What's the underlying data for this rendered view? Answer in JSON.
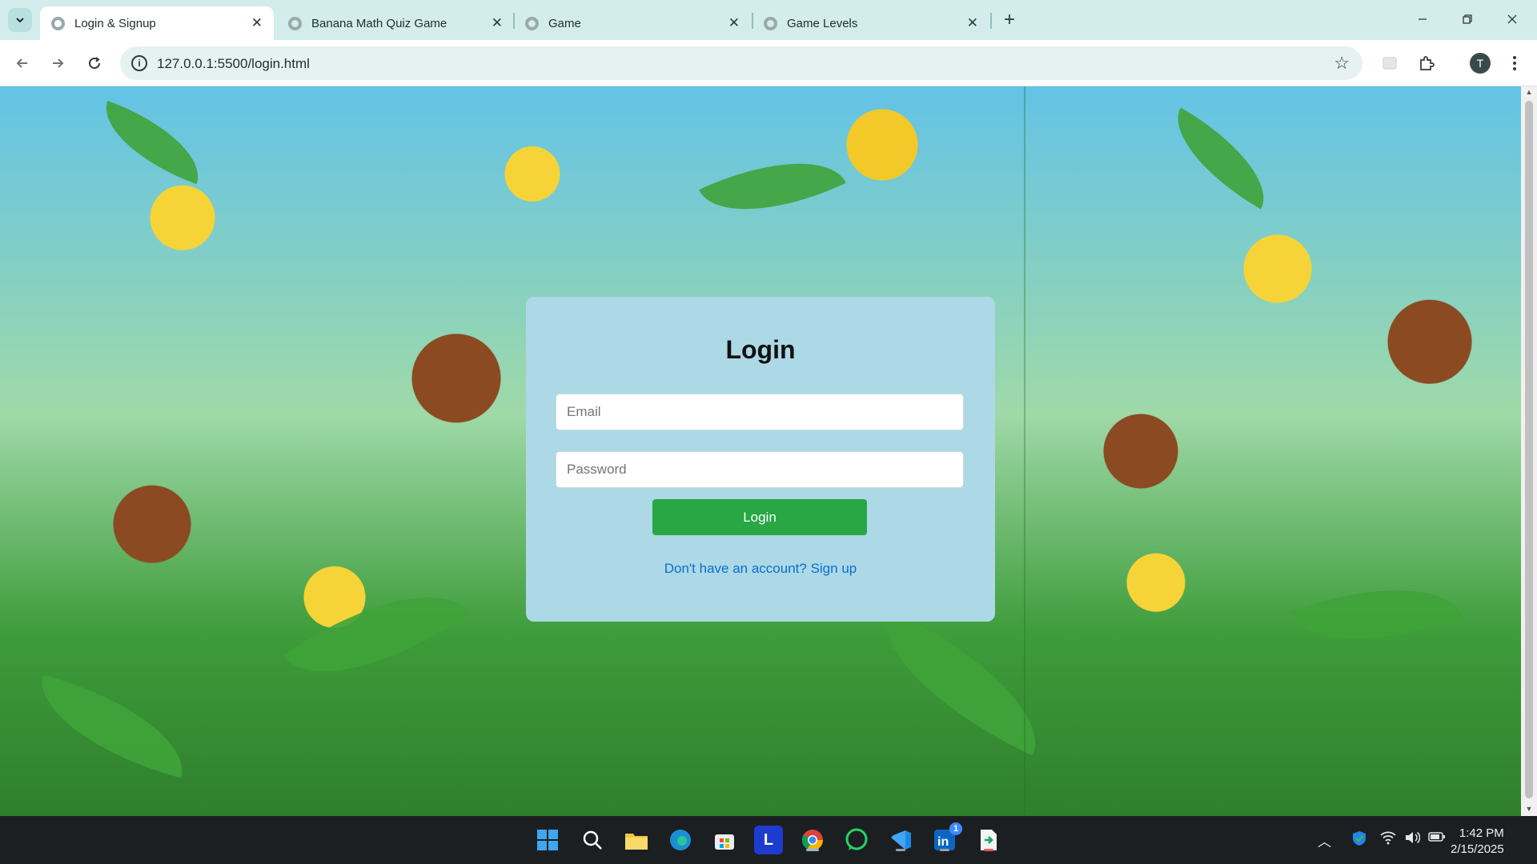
{
  "browser": {
    "tabs": [
      {
        "title": "Login & Signup",
        "active": true
      },
      {
        "title": "Banana Math Quiz Game",
        "active": false
      },
      {
        "title": "Game",
        "active": false
      },
      {
        "title": "Game Levels",
        "active": false
      }
    ],
    "close_glyph": "✕",
    "new_tab_glyph": "+",
    "url": "127.0.0.1:5500/login.html",
    "profile_initial": "T"
  },
  "login": {
    "title": "Login",
    "email_placeholder": "Email",
    "password_placeholder": "Password",
    "button_label": "Login",
    "signup_link": "Don't have an account? Sign up"
  },
  "taskbar": {
    "apps": [
      "windows-start",
      "search",
      "file-explorer",
      "edge",
      "microsoft-store",
      "l-app",
      "chrome",
      "whatsapp",
      "vscode",
      "linkedin",
      "file-app"
    ],
    "l_app_letter": "L",
    "linkedin_badge": "1",
    "time": "1:42 PM",
    "date": "2/15/2025"
  },
  "colors": {
    "card_bg": "#add8e6",
    "login_button": "#28a745",
    "link": "#0a6ed1",
    "tab_strip": "#d3ecec"
  },
  "icons": [
    "tab-search-icon",
    "favicon-icon",
    "close-icon",
    "back-icon",
    "forward-icon",
    "reload-icon",
    "info-icon",
    "star-icon",
    "extensions-icon",
    "menu-icon"
  ]
}
